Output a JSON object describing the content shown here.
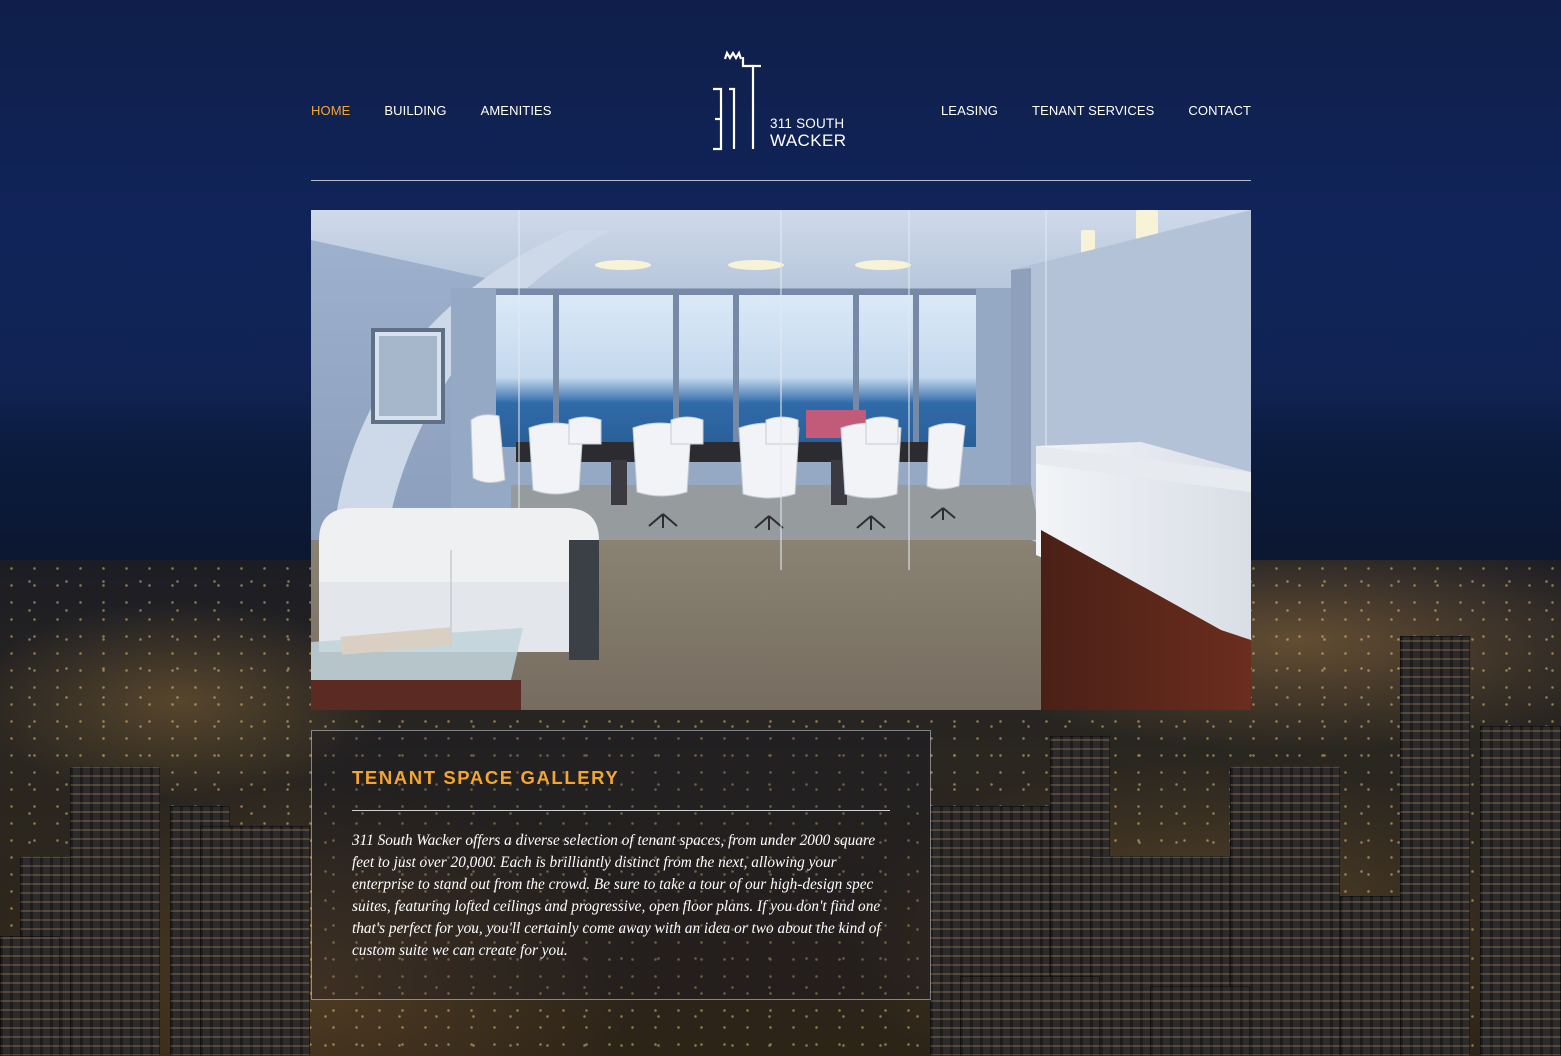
{
  "nav": {
    "left": [
      {
        "label": "HOME",
        "active": true
      },
      {
        "label": "BUILDING",
        "active": false
      },
      {
        "label": "AMENITIES",
        "active": false
      }
    ],
    "right": [
      {
        "label": "LEASING",
        "active": false
      },
      {
        "label": "TENANT SERVICES",
        "active": false
      },
      {
        "label": "CONTACT",
        "active": false
      }
    ]
  },
  "logo": {
    "line1": "311 SOUTH",
    "line2": "WACKER",
    "icon": "building-311-icon"
  },
  "hero": {
    "image": "conference-room-photo"
  },
  "gallery": {
    "title": "TENANT SPACE GALLERY",
    "description": "311 South Wacker offers a diverse selection of tenant spaces, from under 2000 square feet to just over 20,000. Each is brilliantly distinct from the next, allowing your enterprise to stand out from the crowd. Be sure to take a tour of our high-design spec suites, featuring lofted ceilings and progressive, open floor plans. If you don't find one that's perfect for you, you'll certainly come away with an idea or two about the kind of custom suite we can create for you."
  },
  "colors": {
    "accent": "#f3a533",
    "background": "#0f1f4a",
    "text": "#ffffff"
  }
}
